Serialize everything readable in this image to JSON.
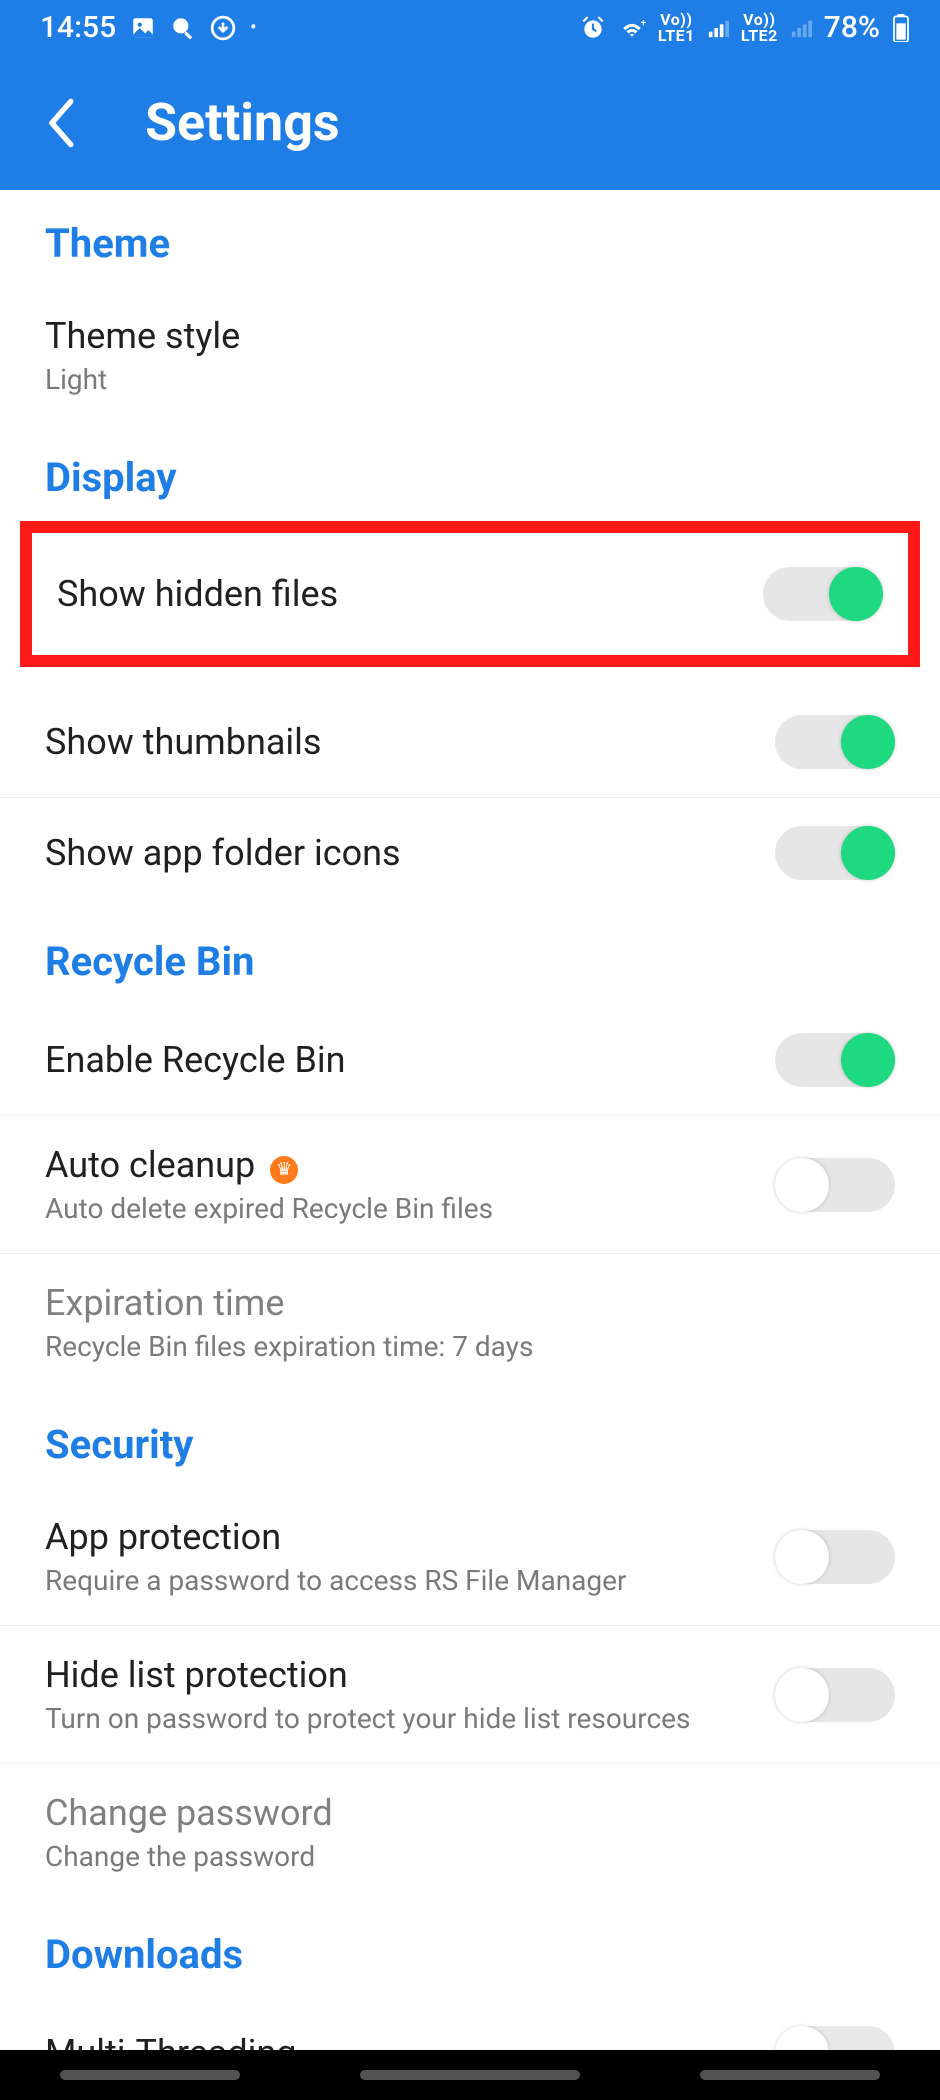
{
  "status": {
    "time": "14:55",
    "battery": "78%",
    "lte1": "LTE1",
    "lte2": "LTE2",
    "vo": "Vo))"
  },
  "header": {
    "title": "Settings"
  },
  "sections": {
    "theme": {
      "header": "Theme",
      "style_label": "Theme style",
      "style_value": "Light"
    },
    "display": {
      "header": "Display",
      "hidden_files": "Show hidden files",
      "thumbnails": "Show thumbnails",
      "folder_icons": "Show app folder icons"
    },
    "recycle": {
      "header": "Recycle Bin",
      "enable": "Enable Recycle Bin",
      "auto_cleanup": "Auto cleanup",
      "auto_cleanup_sub": "Auto delete expired Recycle Bin files",
      "expiration": "Expiration time",
      "expiration_sub": "Recycle Bin files expiration time: 7 days"
    },
    "security": {
      "header": "Security",
      "app_protection": "App protection",
      "app_protection_sub": "Require a password to access RS File Manager",
      "hide_list": "Hide list protection",
      "hide_list_sub": "Turn on password to protect your hide list resources",
      "change_pw": "Change password",
      "change_pw_sub": "Change the password"
    },
    "downloads": {
      "header": "Downloads",
      "multi_threading": "Multi-Threading"
    }
  }
}
